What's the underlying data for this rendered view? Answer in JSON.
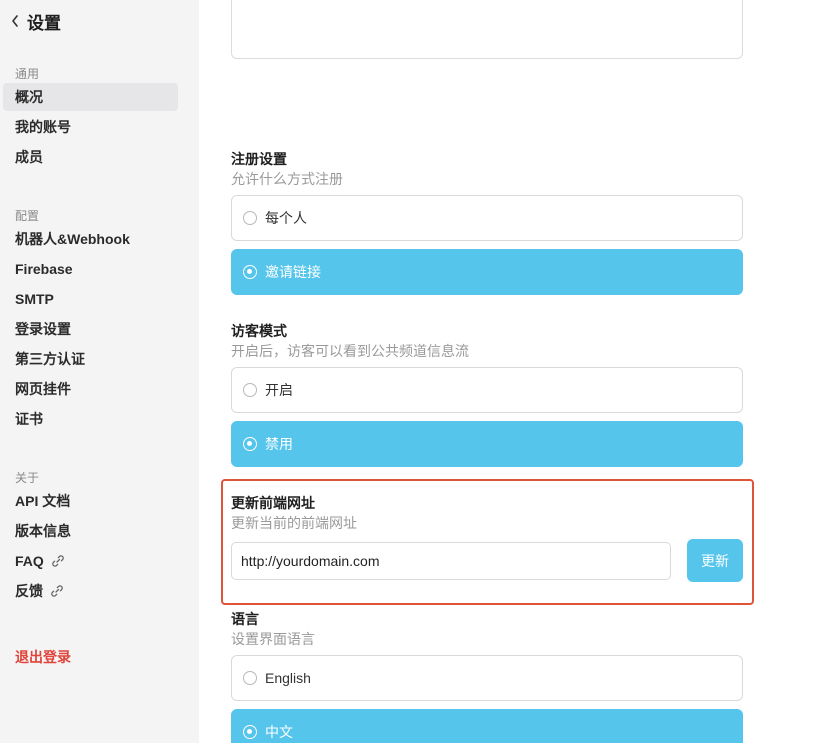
{
  "sidebar": {
    "back_icon": "chevron-left-icon",
    "title": "设置",
    "sections": {
      "general": "通用",
      "config": "配置",
      "about": "关于"
    },
    "items": {
      "overview": "概况",
      "my_account": "我的账号",
      "members": "成员",
      "bots_webhook": "机器人&Webhook",
      "firebase": "Firebase",
      "smtp": "SMTP",
      "login_settings": "登录设置",
      "third_party_auth": "第三方认证",
      "web_widget": "网页挂件",
      "certificate": "证书",
      "api_docs": "API 文档",
      "version_info": "版本信息",
      "faq": "FAQ",
      "feedback": "反馈"
    },
    "link_icon": "link-icon",
    "logout": "退出登录"
  },
  "registration": {
    "title": "注册设置",
    "desc": "允许什么方式注册",
    "options": [
      "每个人",
      "邀请链接"
    ],
    "selected": "邀请链接"
  },
  "guest_mode": {
    "title": "访客模式",
    "desc": "开启后，访客可以看到公共频道信息流",
    "options": [
      "开启",
      "禁用"
    ],
    "selected": "禁用"
  },
  "frontend_url": {
    "title": "更新前端网址",
    "desc": "更新当前的前端网址",
    "value": "http://yourdomain.com",
    "button": "更新"
  },
  "language": {
    "title": "语言",
    "desc": "设置界面语言",
    "options": [
      "English",
      "中文"
    ],
    "selected": "中文"
  },
  "colors": {
    "accent": "#55c5eb",
    "highlight": "#e0553a",
    "logout": "#e0443a",
    "sidebar_bg": "#f4f4f5"
  }
}
